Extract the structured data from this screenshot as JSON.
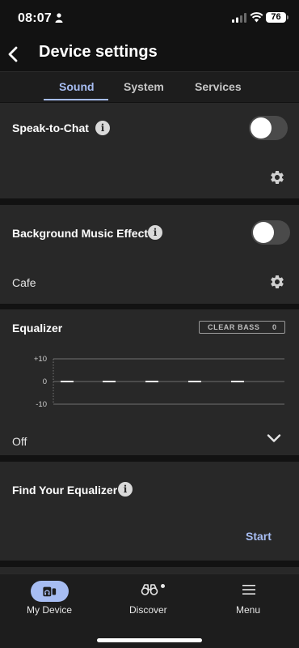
{
  "status_bar": {
    "time": "08:07",
    "battery": "76"
  },
  "header": {
    "title": "Device settings"
  },
  "tabs": [
    {
      "label": "Sound",
      "active": true
    },
    {
      "label": "System",
      "active": false
    },
    {
      "label": "Services",
      "active": false
    }
  ],
  "speak_to_chat": {
    "label": "Speak-to-Chat",
    "enabled": false
  },
  "background_music": {
    "label": "Background Music Effect",
    "enabled": false,
    "value": "Cafe"
  },
  "equalizer": {
    "label": "Equalizer",
    "clear_bass_label": "CLEAR BASS",
    "clear_bass_value": "0",
    "y_ticks": [
      "+10",
      "0",
      "-10"
    ],
    "bands": [
      0,
      0,
      0,
      0,
      0
    ],
    "preset": "Off"
  },
  "find_equalizer": {
    "label": "Find Your Equalizer",
    "action": "Start"
  },
  "bottom_nav": [
    {
      "label": "My Device",
      "active": true,
      "icon": "headphones-icon"
    },
    {
      "label": "Discover",
      "active": false,
      "icon": "binoculars-icon"
    },
    {
      "label": "Menu",
      "active": false,
      "icon": "hamburger-icon"
    }
  ],
  "colors": {
    "accent": "#a7bdf2",
    "card": "#282828",
    "background": "#121212"
  }
}
